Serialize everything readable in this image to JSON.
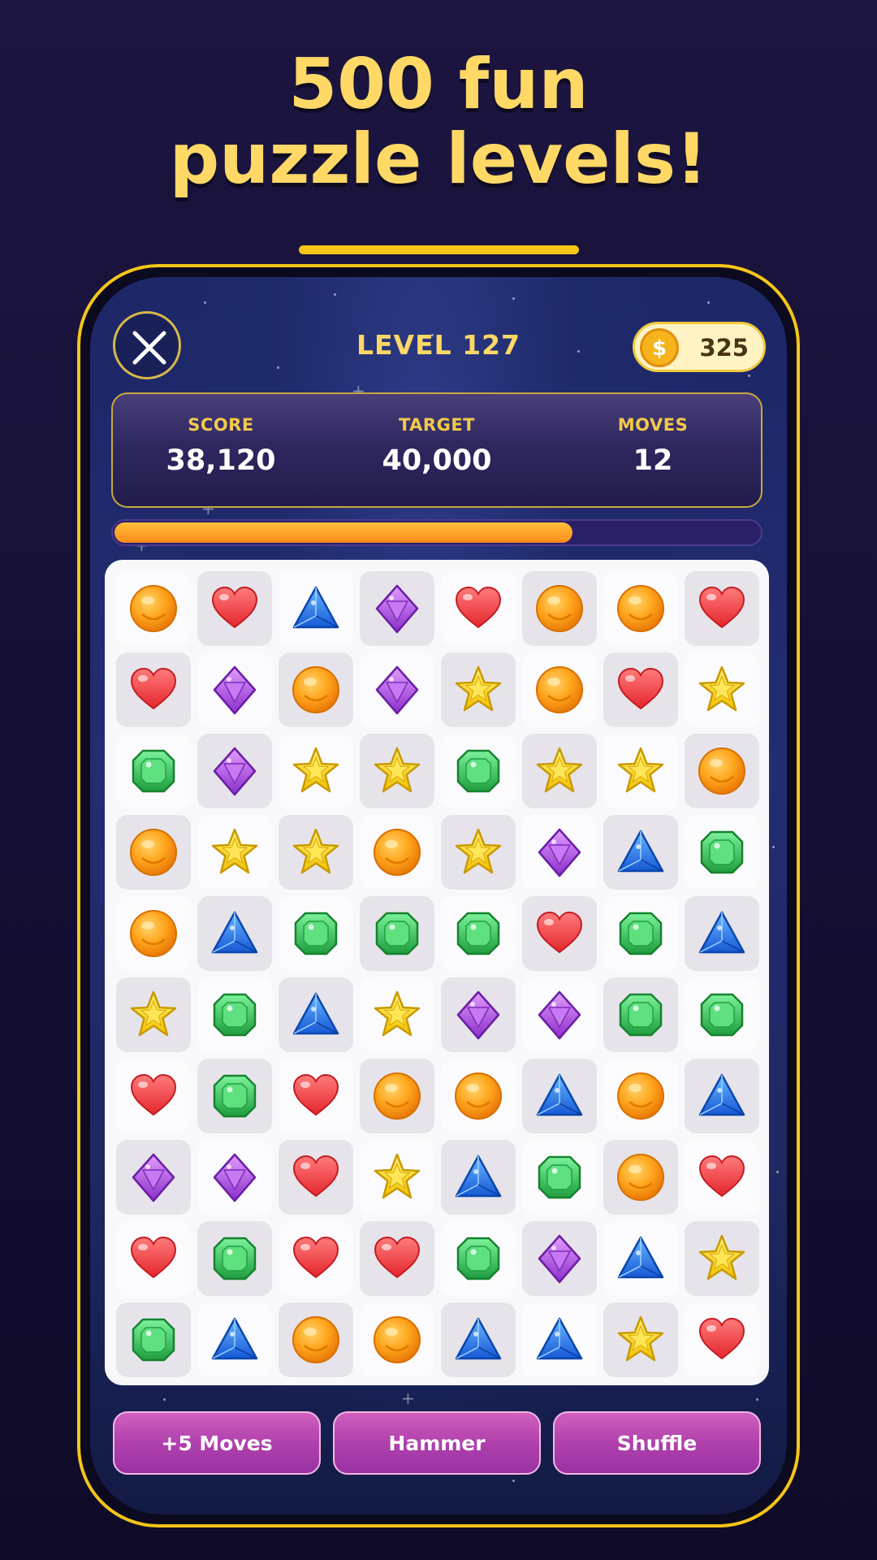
{
  "headline": {
    "line1": "500 fun",
    "line2": "puzzle levels!"
  },
  "header": {
    "level_title": "LEVEL 127",
    "coins": "325",
    "coin_symbol": "$"
  },
  "stats": {
    "score_label": "SCORE",
    "score_value": "38,120",
    "target_label": "TARGET",
    "target_value": "40,000",
    "moves_label": "MOVES",
    "moves_value": "12"
  },
  "progress": {
    "fraction": 0.71
  },
  "board": {
    "rows": [
      [
        "orange",
        "heart",
        "blue",
        "purple",
        "heart",
        "orange",
        "orange",
        "heart"
      ],
      [
        "heart",
        "purple",
        "orange",
        "purple",
        "star",
        "orange",
        "heart",
        "star"
      ],
      [
        "green",
        "purple",
        "star",
        "star",
        "green",
        "star",
        "star",
        "orange"
      ],
      [
        "orange",
        "star",
        "star",
        "orange",
        "star",
        "purple",
        "blue",
        "green"
      ],
      [
        "orange",
        "blue",
        "green",
        "green",
        "green",
        "heart",
        "green",
        "blue"
      ],
      [
        "star",
        "green",
        "blue",
        "star",
        "purple",
        "purple",
        "green",
        "green"
      ],
      [
        "heart",
        "green",
        "heart",
        "orange",
        "orange",
        "blue",
        "orange",
        "blue"
      ],
      [
        "purple",
        "purple",
        "heart",
        "star",
        "blue",
        "green",
        "orange",
        "heart"
      ],
      [
        "heart",
        "green",
        "heart",
        "heart",
        "green",
        "purple",
        "blue",
        "star"
      ],
      [
        "green",
        "blue",
        "orange",
        "orange",
        "blue",
        "blue",
        "star",
        "heart"
      ]
    ]
  },
  "boosters": [
    {
      "label": "+5 Moves"
    },
    {
      "label": "Hammer"
    },
    {
      "label": "Shuffle"
    }
  ],
  "colors": {
    "accent": "#f5c518",
    "headline": "#ffd866",
    "booster": "#b041ad",
    "progress": "#ff8a1a"
  }
}
